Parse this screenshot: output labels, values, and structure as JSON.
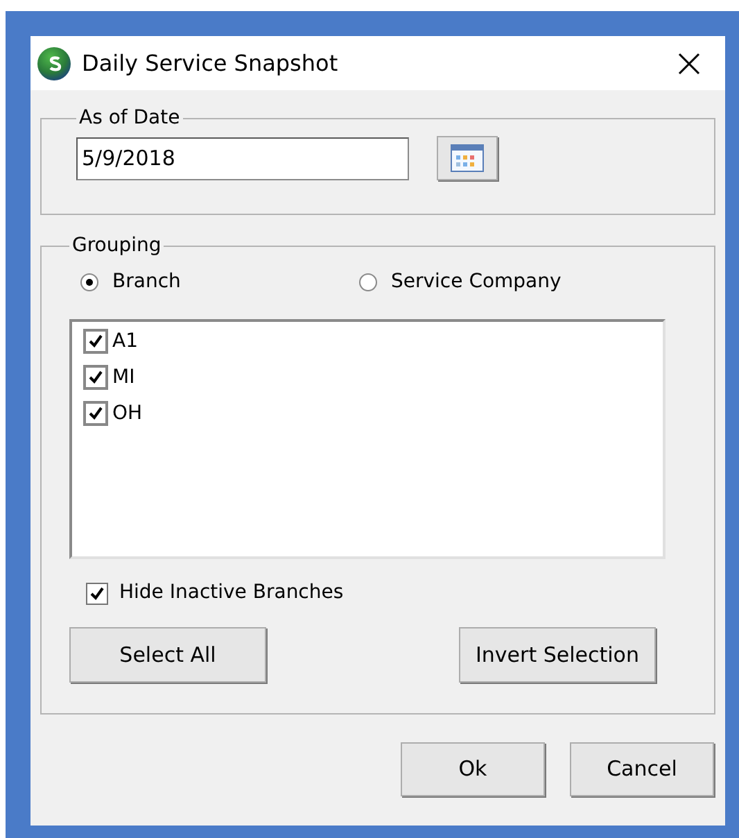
{
  "window": {
    "title": "Daily Service Snapshot"
  },
  "as_of_date": {
    "legend": "As of Date",
    "value": "5/9/2018"
  },
  "grouping": {
    "legend": "Grouping",
    "options": [
      {
        "label": "Branch",
        "selected": true
      },
      {
        "label": "Service Company",
        "selected": false
      }
    ],
    "items": [
      {
        "label": "A1",
        "checked": true
      },
      {
        "label": "MI",
        "checked": true
      },
      {
        "label": "OH",
        "checked": true
      }
    ],
    "hide_inactive": {
      "label": "Hide Inactive Branches",
      "checked": true
    },
    "buttons": [
      "Select All",
      "Invert Selection"
    ]
  },
  "buttons": [
    "Ok",
    "Cancel"
  ]
}
